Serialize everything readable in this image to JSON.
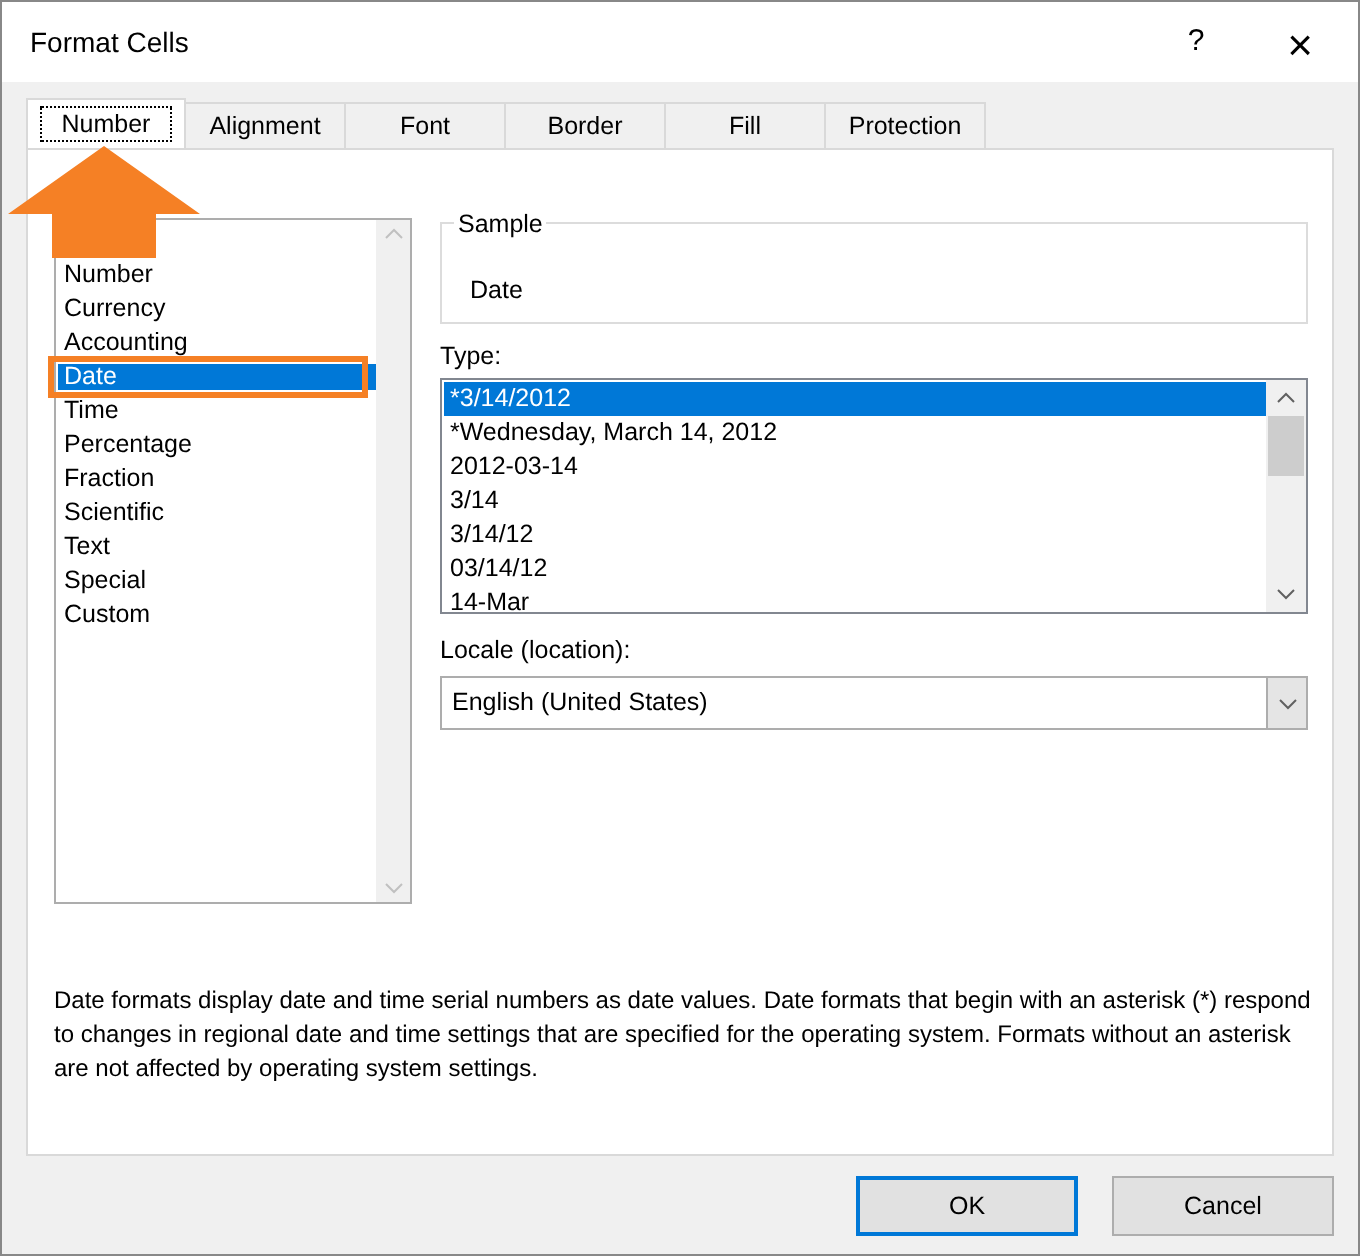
{
  "window": {
    "title": "Format Cells",
    "help": "?",
    "close": "×"
  },
  "tabs": [
    {
      "label": "Number",
      "selected": true
    },
    {
      "label": "Alignment",
      "selected": false
    },
    {
      "label": "Font",
      "selected": false
    },
    {
      "label": "Border",
      "selected": false
    },
    {
      "label": "Fill",
      "selected": false
    },
    {
      "label": "Protection",
      "selected": false
    }
  ],
  "category": {
    "items": [
      {
        "label": "Number",
        "selected": false
      },
      {
        "label": "Currency",
        "selected": false
      },
      {
        "label": "Accounting",
        "selected": false
      },
      {
        "label": "Date",
        "selected": true
      },
      {
        "label": "Time",
        "selected": false
      },
      {
        "label": "Percentage",
        "selected": false
      },
      {
        "label": "Fraction",
        "selected": false
      },
      {
        "label": "Scientific",
        "selected": false
      },
      {
        "label": "Text",
        "selected": false
      },
      {
        "label": "Special",
        "selected": false
      },
      {
        "label": "Custom",
        "selected": false
      }
    ]
  },
  "sample": {
    "label": "Sample",
    "value": "Date"
  },
  "type": {
    "label": "Type:",
    "items": [
      {
        "label": "*3/14/2012",
        "selected": true
      },
      {
        "label": "*Wednesday, March 14, 2012",
        "selected": false
      },
      {
        "label": "2012-03-14",
        "selected": false
      },
      {
        "label": "3/14",
        "selected": false
      },
      {
        "label": "3/14/12",
        "selected": false
      },
      {
        "label": "03/14/12",
        "selected": false
      },
      {
        "label": "14-Mar",
        "selected": false
      }
    ]
  },
  "locale": {
    "label": "Locale (location):",
    "value": "English (United States)"
  },
  "description": "Date formats display date and time serial numbers as date values.  Date formats that begin with an asterisk (*) respond to changes in regional date and time settings that are specified for the operating system. Formats without an asterisk are not affected by operating system settings.",
  "buttons": [
    {
      "label": "OK",
      "default": true
    },
    {
      "label": "Cancel",
      "default": false
    }
  ]
}
